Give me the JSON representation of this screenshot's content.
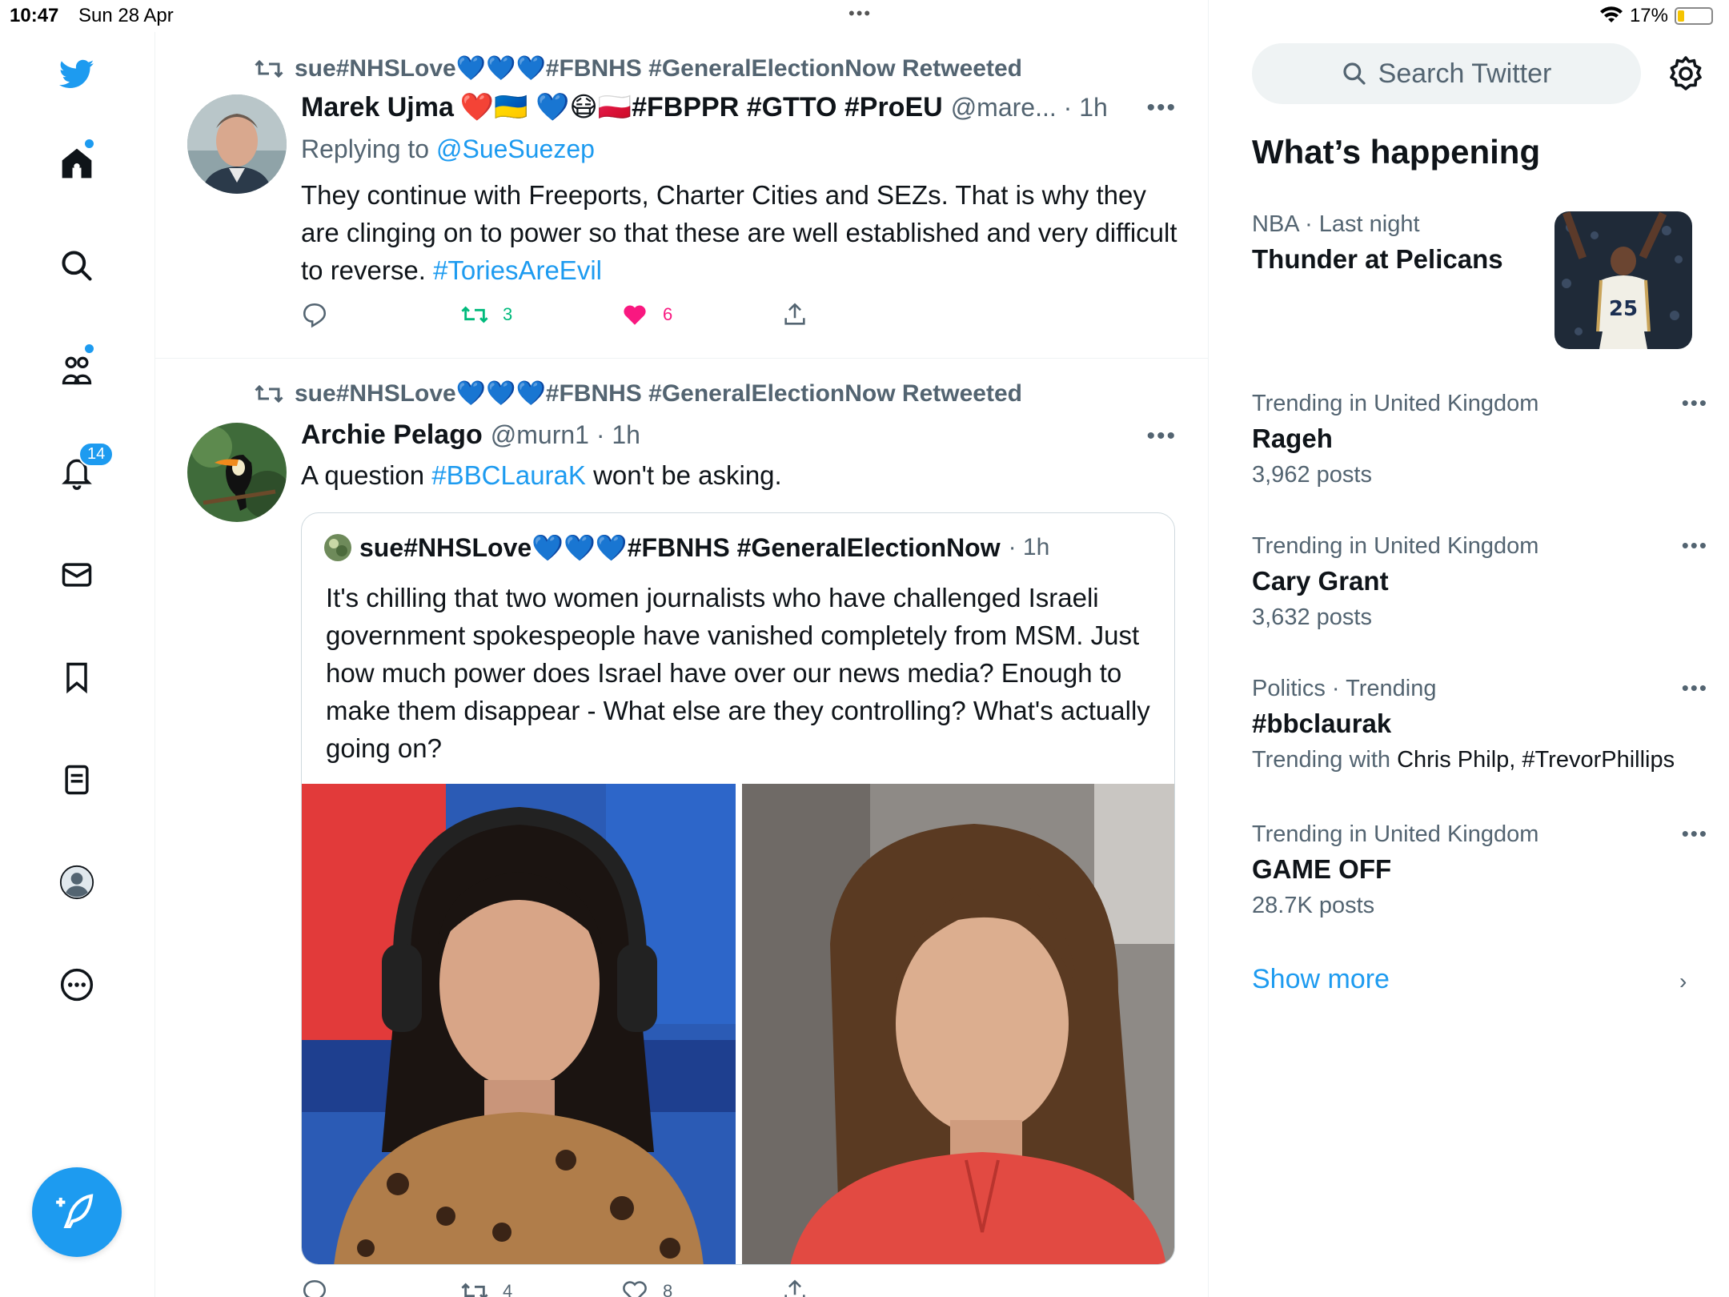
{
  "status_bar": {
    "time": "10:47",
    "date": "Sun 28 Apr",
    "battery": "17%"
  },
  "nav": {
    "notifications_badge": "14"
  },
  "tweets": [
    {
      "retweeted_by": "sue#NHSLove💙💙💙#FBNHS #GeneralElectionNow Retweeted",
      "name": "Marek Ujma",
      "name_suffix": "❤️🇺🇦 💙😷🇵🇱#FBPPR #GTTO #ProEU",
      "handle": "@mare... · 1h",
      "replying_label": "Replying to",
      "replying_to": "@SueSuezep",
      "text": "They continue with Freeports, Charter Cities and SEZs. That is why they are clinging on to power so that these are well established and very difficult to reverse.",
      "hashtag": "#ToriesAreEvil",
      "retweets": "3",
      "likes": "6"
    },
    {
      "retweeted_by": "sue#NHSLove💙💙💙#FBNHS #GeneralElectionNow Retweeted",
      "name": "Archie Pelago",
      "handle": "@murn1 · 1h",
      "text_before": "A question",
      "hashtag": "#BBCLauraK",
      "text_after": "won't be asking.",
      "quote": {
        "name": "sue#NHSLove💙💙💙#FBNHS #GeneralElectionNow",
        "time": "· 1h",
        "text": "It's chilling that two women journalists who have challenged Israeli government spokespeople have vanished completely from MSM. Just how much power does Israel have over our news media? Enough to make them disappear - What else are they controlling?  What's actually going on?"
      },
      "retweets": "4",
      "likes": "8"
    }
  ],
  "sidebar": {
    "search_placeholder": "Search Twitter",
    "section_title": "What’s happening",
    "trends": [
      {
        "meta": "NBA · Last night",
        "title": "Thunder at Pelicans",
        "sub": ""
      },
      {
        "meta": "Trending in United Kingdom",
        "title": "Rageh",
        "sub": "3,962 posts"
      },
      {
        "meta": "Trending in United Kingdom",
        "title": "Cary Grant",
        "sub": "3,632 posts"
      },
      {
        "meta": "Politics · Trending",
        "title": "#bbclaurak",
        "sub_prefix": "Trending with",
        "sub_names": "Chris Philp, #TrevorPhillips"
      },
      {
        "meta": "Trending in United Kingdom",
        "title": "GAME OFF",
        "sub": "28.7K posts"
      }
    ],
    "show_more": "Show more",
    "image_jersey": "25"
  }
}
